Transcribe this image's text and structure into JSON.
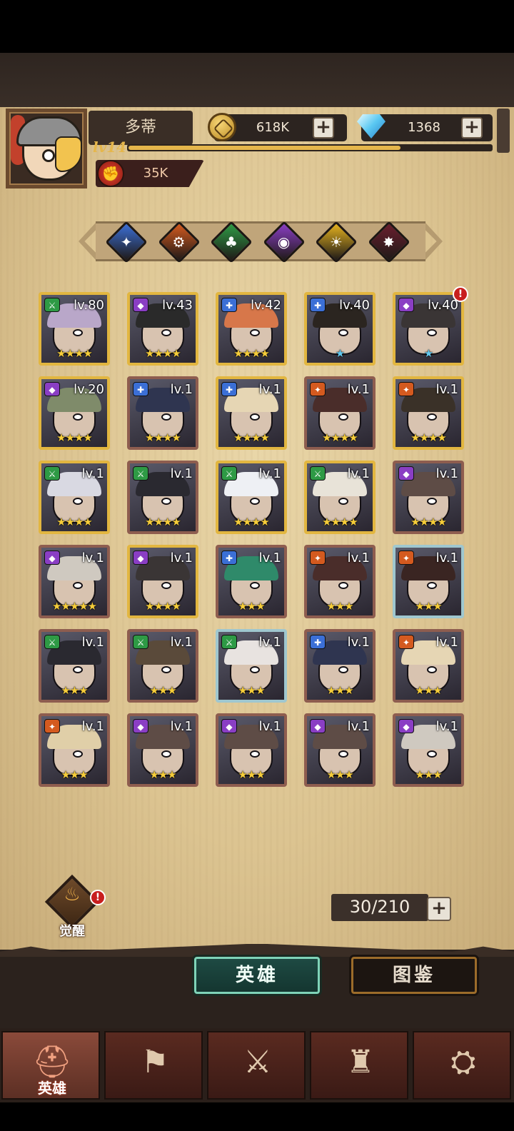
{
  "profile": {
    "name": "多蒂",
    "level": "lv14",
    "xp_fraction": 0.75,
    "power": "35K"
  },
  "resources": {
    "gold": "618K",
    "gems": "1368"
  },
  "element_filters": [
    {
      "name": "lightning",
      "color": "#3b6fd6",
      "glyph": "✦"
    },
    {
      "name": "fire",
      "color": "#d45a1f",
      "glyph": "⚙"
    },
    {
      "name": "nature",
      "color": "#2e9a45",
      "glyph": "♣"
    },
    {
      "name": "shadow",
      "color": "#8a3ec4",
      "glyph": "◉"
    },
    {
      "name": "light",
      "color": "#e4b21f",
      "glyph": "☀"
    },
    {
      "name": "dark",
      "color": "#6a1e2e",
      "glyph": "✸"
    }
  ],
  "heroes": [
    {
      "level": "lv.80",
      "stars": "★★★★",
      "frame": "gold",
      "class_color": "#2e9a45",
      "hair": "#b9a7c9",
      "star_color": "gold"
    },
    {
      "level": "lv.43",
      "stars": "★★★★",
      "frame": "gold",
      "class_color": "#8a3ec4",
      "hair": "#2a2a2a",
      "star_color": "gold"
    },
    {
      "level": "lv.42",
      "stars": "★★★★",
      "frame": "gold",
      "class_color": "#3b6fd6",
      "hair": "#d7774a",
      "star_color": "gold"
    },
    {
      "level": "lv.40",
      "stars": "★",
      "frame": "gold",
      "class_color": "#3b6fd6",
      "hair": "#2b2520",
      "star_color": "blue"
    },
    {
      "level": "lv.40",
      "stars": "★",
      "frame": "gold",
      "class_color": "#8a3ec4",
      "hair": "#3a3535",
      "star_color": "blue",
      "alert": "!"
    },
    {
      "level": "lv.20",
      "stars": "★★★★",
      "frame": "gold",
      "class_color": "#8a3ec4",
      "hair": "#7f8b6a",
      "star_color": "gold"
    },
    {
      "level": "lv.1",
      "stars": "★★★★",
      "frame": "bronze",
      "class_color": "#3b6fd6",
      "hair": "#2f3550",
      "star_color": "gold"
    },
    {
      "level": "lv.1",
      "stars": "★★★★",
      "frame": "gold",
      "class_color": "#3b6fd6",
      "hair": "#e6d6b4",
      "star_color": "gold"
    },
    {
      "level": "lv.1",
      "stars": "★★★★",
      "frame": "bronze",
      "class_color": "#d45a1f",
      "hair": "#4a2d2a",
      "star_color": "gold"
    },
    {
      "level": "lv.1",
      "stars": "★★★★",
      "frame": "gold",
      "class_color": "#d45a1f",
      "hair": "#3a3128",
      "star_color": "gold"
    },
    {
      "level": "lv.1",
      "stars": "★★★★",
      "frame": "gold",
      "class_color": "#2e9a45",
      "hair": "#d9d9e2",
      "star_color": "gold"
    },
    {
      "level": "lv.1",
      "stars": "★★★★",
      "frame": "bronze",
      "class_color": "#2e9a45",
      "hair": "#2a2930",
      "star_color": "gold"
    },
    {
      "level": "lv.1",
      "stars": "★★★★",
      "frame": "gold",
      "class_color": "#2e9a45",
      "hair": "#eef0f4",
      "star_color": "gold"
    },
    {
      "level": "lv.1",
      "stars": "★★★★",
      "frame": "gold",
      "class_color": "#2e9a45",
      "hair": "#e8e3d8",
      "star_color": "gold"
    },
    {
      "level": "lv.1",
      "stars": "★★★★",
      "frame": "bronze",
      "class_color": "#8a3ec4",
      "hair": "#5e4c46",
      "star_color": "gold"
    },
    {
      "level": "lv.1",
      "stars": "★★★★★",
      "frame": "bronze",
      "class_color": "#8a3ec4",
      "hair": "#cfc9c0",
      "star_color": "gold"
    },
    {
      "level": "lv.1",
      "stars": "★★★★",
      "frame": "gold",
      "class_color": "#8a3ec4",
      "hair": "#3a3535",
      "star_color": "gold"
    },
    {
      "level": "lv.1",
      "stars": "★★★",
      "frame": "bronze",
      "class_color": "#3b6fd6",
      "hair": "#2f8a6a",
      "star_color": "gold"
    },
    {
      "level": "lv.1",
      "stars": "★★★",
      "frame": "bronze",
      "class_color": "#d45a1f",
      "hair": "#4a2d2a",
      "star_color": "gold"
    },
    {
      "level": "lv.1",
      "stars": "★★★",
      "frame": "steel",
      "class_color": "#d45a1f",
      "hair": "#3a2522",
      "star_color": "gold"
    },
    {
      "level": "lv.1",
      "stars": "★★★",
      "frame": "bronze",
      "class_color": "#2e9a45",
      "hair": "#2a2930",
      "star_color": "gold"
    },
    {
      "level": "lv.1",
      "stars": "★★★",
      "frame": "bronze",
      "class_color": "#2e9a45",
      "hair": "#5a4a3a",
      "star_color": "gold"
    },
    {
      "level": "lv.1",
      "stars": "★★★",
      "frame": "steel",
      "class_color": "#2e9a45",
      "hair": "#e8e3e0",
      "star_color": "gold"
    },
    {
      "level": "lv.1",
      "stars": "★★★",
      "frame": "bronze",
      "class_color": "#3b6fd6",
      "hair": "#2f3550",
      "star_color": "gold"
    },
    {
      "level": "lv.1",
      "stars": "★★★",
      "frame": "bronze",
      "class_color": "#d45a1f",
      "hair": "#e6d6b4",
      "star_color": "gold"
    },
    {
      "level": "lv.1",
      "stars": "★★★",
      "frame": "bronze",
      "class_color": "#d45a1f",
      "hair": "#e0cfa8",
      "star_color": "gold"
    },
    {
      "level": "lv.1",
      "stars": "★★★",
      "frame": "bronze",
      "class_color": "#8a3ec4",
      "hair": "#5e4c46",
      "star_color": "gold"
    },
    {
      "level": "lv.1",
      "stars": "★★★",
      "frame": "bronze",
      "class_color": "#8a3ec4",
      "hair": "#5e4c46",
      "star_color": "gold"
    },
    {
      "level": "lv.1",
      "stars": "★★★",
      "frame": "bronze",
      "class_color": "#8a3ec4",
      "hair": "#5e4c46",
      "star_color": "gold"
    },
    {
      "level": "lv.1",
      "stars": "★★★",
      "frame": "bronze",
      "class_color": "#8a3ec4",
      "hair": "#cfc9c0",
      "star_color": "gold"
    }
  ],
  "awaken": {
    "label": "觉醒",
    "alert": "!"
  },
  "capacity": "30/210",
  "tabs": {
    "heroes": "英雄",
    "codex": "图鉴"
  },
  "nav": [
    {
      "icon": "helmet-icon",
      "label": "英雄",
      "active": true
    },
    {
      "icon": "war-flag-icon",
      "label": "",
      "active": false
    },
    {
      "icon": "crossed-swords-icon",
      "label": "",
      "active": false
    },
    {
      "icon": "castle-icon",
      "label": "",
      "active": false
    },
    {
      "icon": "guild-handshake-icon",
      "label": "",
      "active": false
    }
  ]
}
